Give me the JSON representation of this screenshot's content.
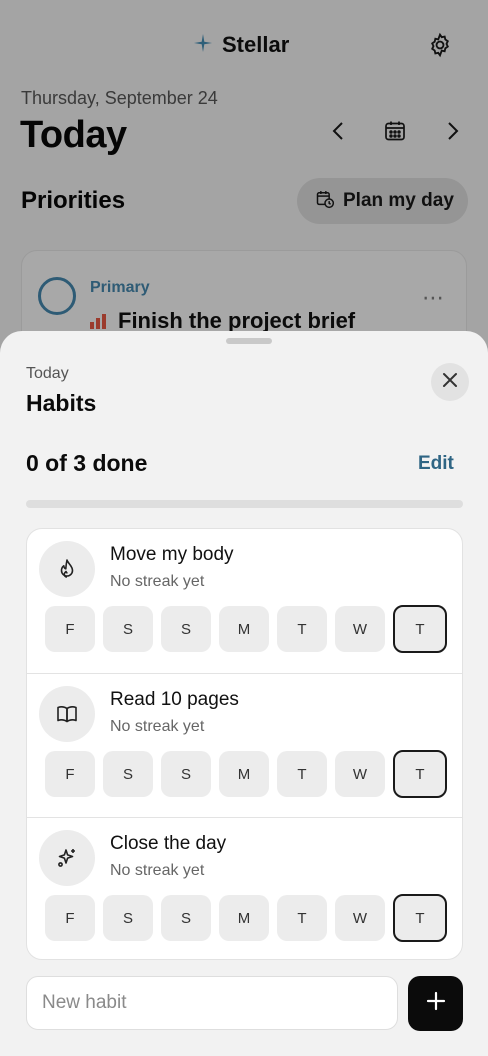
{
  "app": {
    "name": "Stellar",
    "icon": "sparkle-icon"
  },
  "header": {
    "date": "Thursday, September 24",
    "title": "Today",
    "prev_icon": "chevron-left-icon",
    "calendar_icon": "calendar-icon",
    "next_icon": "chevron-right-icon",
    "settings_icon": "gear-icon"
  },
  "priorities": {
    "heading": "Priorities",
    "plan_button_label": "Plan my day",
    "task": {
      "category": "Primary",
      "title": "Finish the project brief",
      "priority_icon": "priority-bars-icon"
    }
  },
  "sheet": {
    "subtitle": "Today",
    "title": "Habits",
    "done_label": "0 of 3 done",
    "edit_label": "Edit",
    "progress_fraction": 0,
    "habits": [
      {
        "name": "Move my body",
        "streak": "No streak yet",
        "icon": "flame-icon"
      },
      {
        "name": "Read 10 pages",
        "streak": "No streak yet",
        "icon": "book-icon"
      },
      {
        "name": "Close the day",
        "streak": "No streak yet",
        "icon": "sparkles-icon"
      }
    ],
    "days": [
      "F",
      "S",
      "S",
      "M",
      "T",
      "W",
      "T"
    ],
    "current_day_index": 6,
    "new_habit_placeholder": "New habit"
  },
  "colors": {
    "accent": "#2f6584",
    "priority": "#9b3b2d",
    "add_button": "#0b0b0b"
  }
}
